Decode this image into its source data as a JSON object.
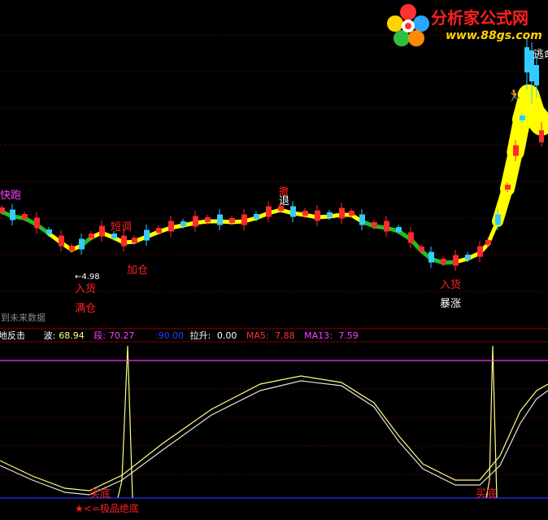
{
  "logo": {
    "site_name": "分析家公式网",
    "url": "www.88gs.com",
    "brand_colors": [
      "#ff2020",
      "#ffd400",
      "#2aa6ff"
    ]
  },
  "upper_labels": {
    "kuaipao": "快跑",
    "duandiao": "短调",
    "jiacang": "加仓",
    "rukuo_left": "入货",
    "mancang": "满仓",
    "low_value": "4.98",
    "tui": "退",
    "xiao": "撤",
    "rukuo_right": "入货",
    "baozhang": "暴涨",
    "taoming": "逃命",
    "future_data": "用到未来数据"
  },
  "indicator_bar": {
    "name": "绝地反击",
    "bo_label": "波:",
    "bo_value": "68.94",
    "duan_label": "段:",
    "duan_value": "70.27",
    "blue_value": ":90.00",
    "lasheng_label": "拉升:",
    "lasheng_value": "0.00",
    "ma5_label": "MA5:",
    "ma5_value": "7.88",
    "ma13_label": "MA13:",
    "ma13_value": "7.59"
  },
  "lower_labels": {
    "maidi_left": "买底",
    "maidi_right": "买底",
    "star_text": "★<=极品绝底"
  },
  "colors": {
    "background": "#000000",
    "grid": "#5a0000",
    "up_candle": "#ff2a2a",
    "down_candle": "#33ccff",
    "trend_green": "#20c020",
    "trend_yellow": "#ffff00",
    "indicator_line": "#ffff80",
    "indicator_line2": "#e0e0e0",
    "magenta": "#ff30ff",
    "blue": "#2030ff",
    "red_text": "#ff2020",
    "yellow_text": "#ffff00"
  },
  "chart_data": [
    {
      "type": "candlestick",
      "title": "",
      "annotated_low": 4.98,
      "trend_band": "green / yellow segments"
    },
    {
      "type": "line",
      "title": "绝地反击",
      "series": [
        {
          "name": "波",
          "last": 68.94
        },
        {
          "name": "段",
          "last": 70.27
        },
        {
          "name": "拉升",
          "last": 0.0
        },
        {
          "name": "MA5",
          "last": 7.88
        },
        {
          "name": "MA13",
          "last": 7.59
        }
      ],
      "reference_level": 90.0
    }
  ]
}
